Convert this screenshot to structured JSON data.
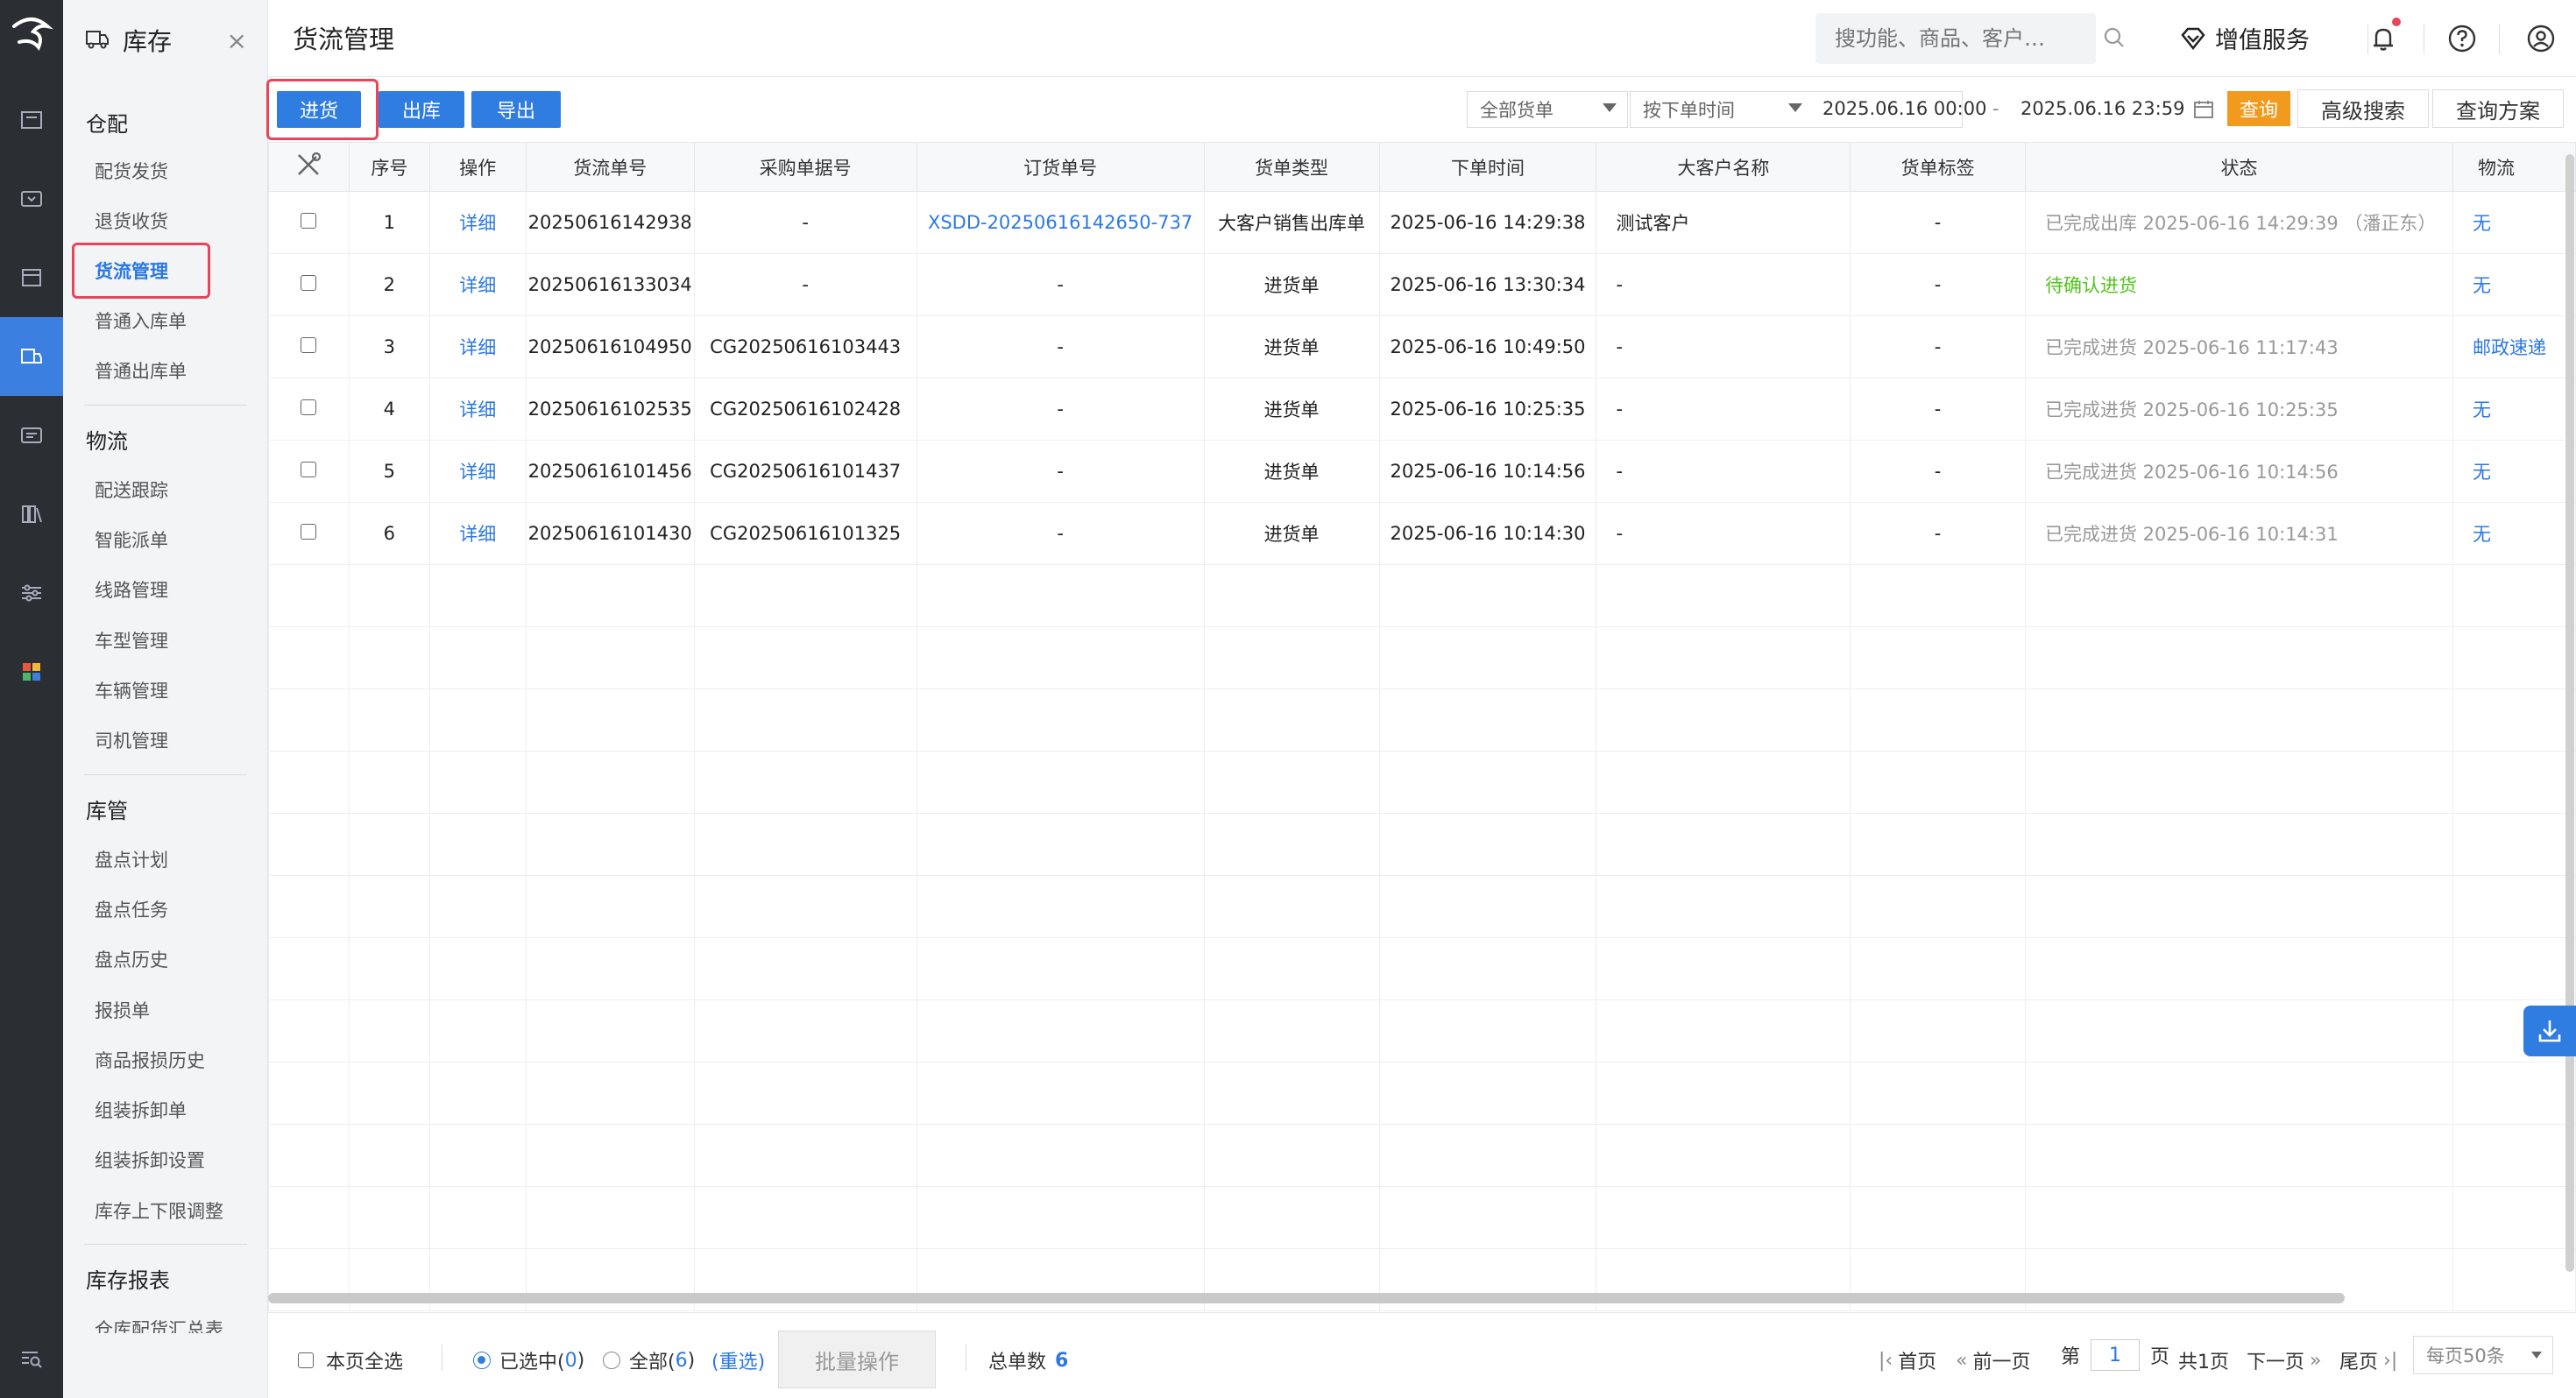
{
  "colors": {
    "primary": "#2f7de1",
    "link": "#2b78e4",
    "orange": "#f19a1e",
    "highlight_border": "#e8455b",
    "success": "#52c41a",
    "rail_bg": "#2b2f33"
  },
  "icon_rail": {
    "items": [
      "logo-icon",
      "board-icon",
      "wallet-icon",
      "box-icon",
      "inventory-icon",
      "report-icon",
      "books-icon",
      "sliders-icon",
      "apps-icon",
      "menu-search-icon"
    ],
    "active_index": 4
  },
  "subnav": {
    "title": "库存",
    "close_glyph": "×",
    "groups": [
      {
        "title": "仓配",
        "items": [
          "配货发货",
          "退货收货",
          "货流管理",
          "普通入库单",
          "普通出库单"
        ]
      },
      {
        "title": "物流",
        "items": [
          "配送跟踪",
          "智能派单",
          "线路管理",
          "车型管理",
          "车辆管理",
          "司机管理"
        ]
      },
      {
        "title": "库管",
        "items": [
          "盘点计划",
          "盘点任务",
          "盘点历史",
          "报损单",
          "商品报损历史",
          "组装拆卸单",
          "组装拆卸设置",
          "库存上下限调整"
        ]
      },
      {
        "title": "库存报表",
        "items": [
          "仓库配货汇总表"
        ]
      }
    ],
    "active_item": "货流管理"
  },
  "topbar": {
    "page_title": "货流管理",
    "search_placeholder": "搜功能、商品、客户…",
    "vip_label": "增值服务"
  },
  "toolbar": {
    "btn_in": "进货",
    "btn_out": "出库",
    "btn_export": "导出",
    "filter_type": "全部货单",
    "filter_time": "按下单时间",
    "date_start": "2025.06.16 00:00",
    "date_sep": "-",
    "date_end": "2025.06.16 23:59",
    "btn_query": "查询",
    "btn_advanced": "高级搜索",
    "btn_scheme": "查询方案"
  },
  "table": {
    "columns": [
      "",
      "序号",
      "操作",
      "货流单号",
      "采购单据号",
      "订货单号",
      "货单类型",
      "下单时间",
      "大客户名称",
      "货单标签",
      "状态",
      "物流"
    ],
    "rows": [
      {
        "no": "1",
        "op": "详细",
        "flow_no": "20250616142938",
        "purchase_no": "-",
        "order_no": "XSDD-20250616142650-737",
        "type": "大客户销售出库单",
        "time": "2025-06-16 14:29:38",
        "customer": "测试客户",
        "tag": "-",
        "status": "已完成出库 2025-06-16 14:29:39 （潘正东）",
        "status_kind": "gray",
        "logistics": "无"
      },
      {
        "no": "2",
        "op": "详细",
        "flow_no": "20250616133034",
        "purchase_no": "-",
        "order_no": "-",
        "type": "进货单",
        "time": "2025-06-16 13:30:34",
        "customer": "-",
        "tag": "-",
        "status": "待确认进货",
        "status_kind": "green",
        "logistics": "无"
      },
      {
        "no": "3",
        "op": "详细",
        "flow_no": "20250616104950",
        "purchase_no": "CG20250616103443",
        "order_no": "-",
        "type": "进货单",
        "time": "2025-06-16 10:49:50",
        "customer": "-",
        "tag": "-",
        "status": "已完成进货 2025-06-16 11:17:43",
        "status_kind": "gray",
        "logistics": "邮政速递"
      },
      {
        "no": "4",
        "op": "详细",
        "flow_no": "20250616102535",
        "purchase_no": "CG20250616102428",
        "order_no": "-",
        "type": "进货单",
        "time": "2025-06-16 10:25:35",
        "customer": "-",
        "tag": "-",
        "status": "已完成进货 2025-06-16 10:25:35",
        "status_kind": "gray",
        "logistics": "无"
      },
      {
        "no": "5",
        "op": "详细",
        "flow_no": "20250616101456",
        "purchase_no": "CG20250616101437",
        "order_no": "-",
        "type": "进货单",
        "time": "2025-06-16 10:14:56",
        "customer": "-",
        "tag": "-",
        "status": "已完成进货 2025-06-16 10:14:56",
        "status_kind": "gray",
        "logistics": "无"
      },
      {
        "no": "6",
        "op": "详细",
        "flow_no": "20250616101430",
        "purchase_no": "CG20250616101325",
        "order_no": "-",
        "type": "进货单",
        "time": "2025-06-16 10:14:30",
        "customer": "-",
        "tag": "-",
        "status": "已完成进货 2025-06-16 10:14:31",
        "status_kind": "gray",
        "logistics": "无"
      }
    ],
    "empty_rows": 12
  },
  "footer": {
    "select_page": "本页全选",
    "selected_label": "已选中(",
    "selected_count": "0",
    "selected_close": ")",
    "all_label": "全部(",
    "all_count": "6",
    "all_close": ")",
    "reselect": "(重选)",
    "batch": "批量操作",
    "total_label": "总单数",
    "total_value": "6",
    "first": "首页",
    "prev": "前一页",
    "page_prefix": "第",
    "page_value": "1",
    "page_suffix": "页",
    "page_total": "共1页",
    "next": "下一页",
    "last": "尾页",
    "page_size": "每页50条"
  }
}
